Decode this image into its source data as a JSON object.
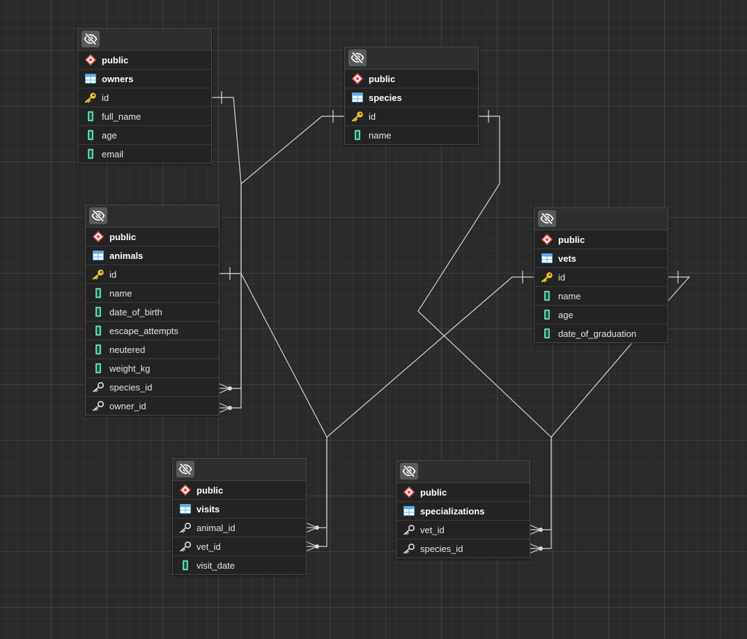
{
  "tables": [
    {
      "id": "owners",
      "schema": "public",
      "name": "owners",
      "columns": [
        {
          "name": "id",
          "kind": "pk"
        },
        {
          "name": "full_name",
          "kind": "col"
        },
        {
          "name": "age",
          "kind": "col"
        },
        {
          "name": "email",
          "kind": "col"
        }
      ]
    },
    {
      "id": "species",
      "schema": "public",
      "name": "species",
      "columns": [
        {
          "name": "id",
          "kind": "pk"
        },
        {
          "name": "name",
          "kind": "col"
        }
      ]
    },
    {
      "id": "animals",
      "schema": "public",
      "name": "animals",
      "columns": [
        {
          "name": "id",
          "kind": "pk"
        },
        {
          "name": "name",
          "kind": "col"
        },
        {
          "name": "date_of_birth",
          "kind": "col"
        },
        {
          "name": "escape_attempts",
          "kind": "col"
        },
        {
          "name": "neutered",
          "kind": "col"
        },
        {
          "name": "weight_kg",
          "kind": "col"
        },
        {
          "name": "species_id",
          "kind": "fk"
        },
        {
          "name": "owner_id",
          "kind": "fk"
        }
      ]
    },
    {
      "id": "vets",
      "schema": "public",
      "name": "vets",
      "columns": [
        {
          "name": "id",
          "kind": "pk"
        },
        {
          "name": "name",
          "kind": "col"
        },
        {
          "name": "age",
          "kind": "col"
        },
        {
          "name": "date_of_graduation",
          "kind": "col"
        }
      ]
    },
    {
      "id": "visits",
      "schema": "public",
      "name": "visits",
      "columns": [
        {
          "name": "animal_id",
          "kind": "fk"
        },
        {
          "name": "vet_id",
          "kind": "fk"
        },
        {
          "name": "visit_date",
          "kind": "col"
        }
      ]
    },
    {
      "id": "specializations",
      "schema": "public",
      "name": "specializations",
      "columns": [
        {
          "name": "vet_id",
          "kind": "fk"
        },
        {
          "name": "species_id",
          "kind": "fk"
        }
      ]
    }
  ],
  "relationships": [
    {
      "from": "animals.owner_id",
      "to": "owners.id",
      "cardinality": "many-to-one"
    },
    {
      "from": "animals.species_id",
      "to": "species.id",
      "cardinality": "many-to-one"
    },
    {
      "from": "visits.animal_id",
      "to": "animals.id",
      "cardinality": "many-to-one"
    },
    {
      "from": "visits.vet_id",
      "to": "vets.id",
      "cardinality": "many-to-one"
    },
    {
      "from": "specializations.vet_id",
      "to": "vets.id",
      "cardinality": "many-to-one"
    },
    {
      "from": "specializations.species_id",
      "to": "species.id",
      "cardinality": "many-to-one"
    }
  ],
  "icons": {
    "visibility": "eye-slash-icon",
    "schema": "schema-diamond-icon",
    "table": "table-grid-icon",
    "pk": "key-icon",
    "fk": "foreign-key-icon",
    "column": "column-icon"
  },
  "colors": {
    "background": "#2a2a2a",
    "table_body": "#232323",
    "text": "#e6e6e6",
    "key": "#f2c02e",
    "schema_icon": "#d9534f",
    "table_icon": "#5aaee0",
    "column_icon": "#5fd3b4",
    "connector": "#d8d8d8"
  }
}
